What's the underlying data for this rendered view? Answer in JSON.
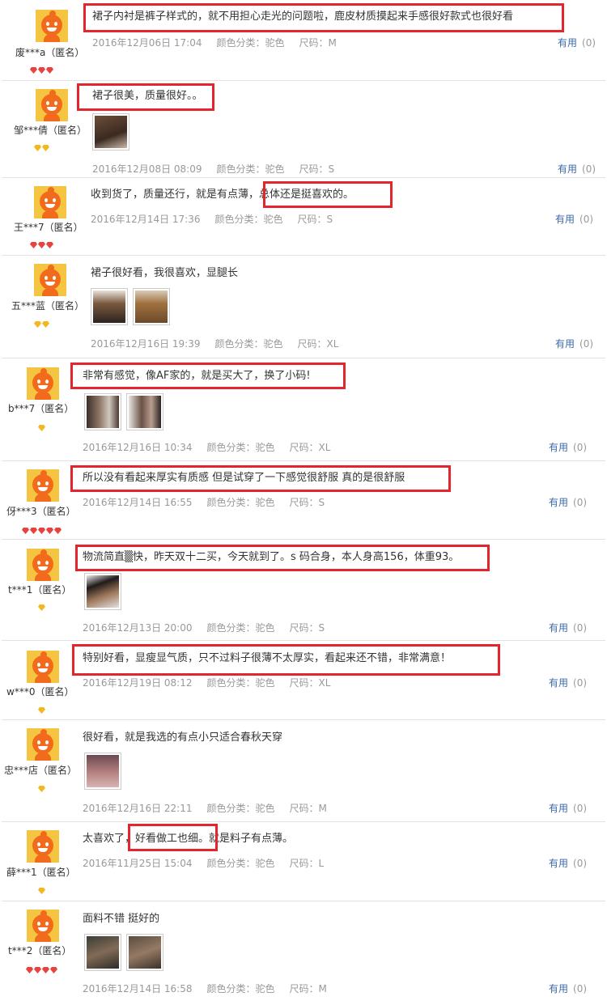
{
  "reviews": [
    {
      "user": "废***a（匿名）",
      "badges": {
        "type": "red",
        "count": 3
      },
      "text": "裙子内衬是裤子样式的，就不用担心走光的问题啦，鹿皮材质摸起来手感很好款式也很好看",
      "date": "2016年12月06日 17:04",
      "color": "颜色分类：驼色",
      "size": "尺码：M",
      "helpful_label": "有用",
      "helpful_count": "(0)",
      "photos": []
    },
    {
      "user": "邹***倩（匿名）",
      "badges": {
        "type": "gold",
        "count": 2
      },
      "text": "裙子很美，质量很好。。",
      "date": "2016年12月08日 08:09",
      "color": "颜色分类：驼色",
      "size": "尺码：S",
      "helpful_label": "有用",
      "helpful_count": "(0)",
      "photos": [
        "photo-brown-skirt"
      ]
    },
    {
      "user": "王***7（匿名）",
      "badges": {
        "type": "red",
        "count": 3
      },
      "text": "收到货了，质量还行，就是有点薄，总体还是挺喜欢的。",
      "date": "2016年12月14日 17:36",
      "color": "颜色分类：驼色",
      "size": "尺码：S",
      "helpful_label": "有用",
      "helpful_count": "(0)",
      "photos": []
    },
    {
      "user": "五***蓝（匿名）",
      "badges": {
        "type": "gold",
        "count": 2
      },
      "text": "裙子很好看，我很喜欢，显腿长",
      "date": "2016年12月16日 19:39",
      "color": "颜色分类：驼色",
      "size": "尺码：XL",
      "helpful_label": "有用",
      "helpful_count": "(0)",
      "photos": [
        "photo-worn-skirt",
        "photo-flat-skirt"
      ]
    },
    {
      "user": "b***7（匿名）",
      "badges": {
        "type": "gold",
        "count": 1
      },
      "text": "非常有感觉，像AF家的，就是买大了，换了小码!",
      "date": "2016年12月16日 10:34",
      "color": "颜色分类：驼色",
      "size": "尺码：XL",
      "helpful_label": "有用",
      "helpful_count": "(0)",
      "photos": [
        "photo-mirror-1",
        "photo-mirror-2"
      ]
    },
    {
      "user": "伢***3（匿名）",
      "badges": {
        "type": "red",
        "count": 5
      },
      "text": "所以没有看起来厚实有质感 但是试穿了一下感觉很舒服 真的是很舒服",
      "date": "2016年12月14日 16:55",
      "color": "颜色分类：驼色",
      "size": "尺码：S",
      "helpful_label": "有用",
      "helpful_count": "(0)",
      "photos": []
    },
    {
      "user": "t***1（匿名）",
      "badges": {
        "type": "gold",
        "count": 1
      },
      "text": "物流简直▒快，昨天双十二买，今天就到了。s 码合身，本人身高156，体重93。",
      "date": "2016年12月13日 20:00",
      "color": "颜色分类：驼色",
      "size": "尺码：S",
      "helpful_label": "有用",
      "helpful_count": "(0)",
      "photos": [
        "photo-worn-short"
      ]
    },
    {
      "user": "w***0（匿名）",
      "badges": {
        "type": "gold",
        "count": 1
      },
      "text": "特别好看，显瘦显气质，只不过料子很薄不太厚实，看起来还不错，非常满意！",
      "date": "2016年12月19日 08:12",
      "color": "颜色分类：驼色",
      "size": "尺码：XL",
      "helpful_label": "有用",
      "helpful_count": "(0)",
      "photos": []
    },
    {
      "user": "忠***店（匿名）",
      "badges": {
        "type": "gold",
        "count": 1
      },
      "text": "很好看，就是我选的有点小只适合春秋天穿",
      "date": "2016年12月16日 22:11",
      "color": "颜色分类：驼色",
      "size": "尺码：M",
      "helpful_label": "有用",
      "helpful_count": "(0)",
      "photos": [
        "photo-skirt-pink"
      ]
    },
    {
      "user": "薛***1（匿名）",
      "badges": {
        "type": "gold",
        "count": 1
      },
      "text": "太喜欢了，好看做工也细。就是料子有点薄。",
      "date": "2016年11月25日 15:04",
      "color": "颜色分类：驼色",
      "size": "尺码：L",
      "helpful_label": "有用",
      "helpful_count": "(0)",
      "photos": []
    },
    {
      "user": "t***2（匿名）",
      "badges": {
        "type": "red",
        "count": 4
      },
      "text": "面料不错 挺好的",
      "date": "2016年12月14日 16:58",
      "color": "颜色分类：驼色",
      "size": "尺码：M",
      "helpful_label": "有用",
      "helpful_count": "(0)",
      "photos": [
        "photo-worn-a",
        "photo-worn-b"
      ]
    }
  ],
  "colors": {
    "highlight": "#e5252e",
    "link": "#3c6aa8",
    "meta": "#999999",
    "divider": "#e2e2e2"
  }
}
